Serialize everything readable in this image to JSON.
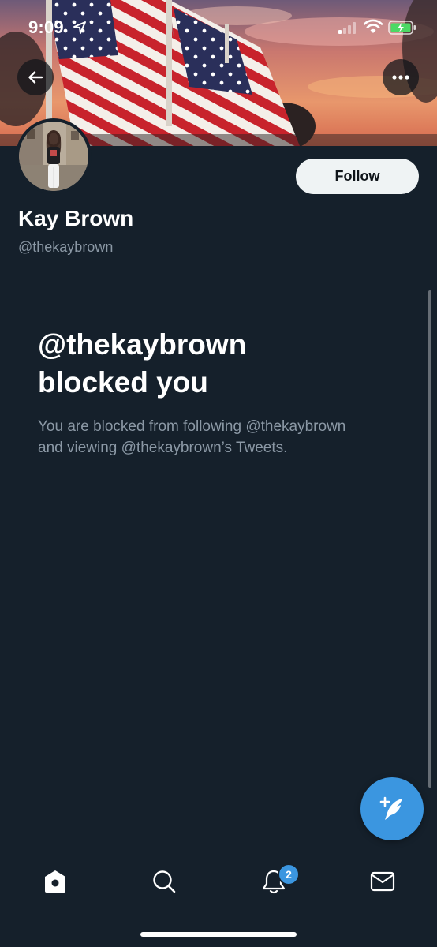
{
  "status_bar": {
    "time": "9:09",
    "icons": [
      "location-arrow-icon",
      "cellular-signal-icon",
      "wifi-icon",
      "battery-charging-icon"
    ]
  },
  "header": {
    "back_icon": "arrow-left-icon",
    "more_icon": "more-horizontal-icon",
    "banner": "american-flags-sunset-photo"
  },
  "profile": {
    "display_name": "Kay Brown",
    "handle": "@thekaybrown",
    "follow_label": "Follow"
  },
  "blocked": {
    "title_line1": "@thekaybrown",
    "title_line2": "blocked you",
    "desc_line1": "You are blocked from following @thekaybrown",
    "desc_line2": "and viewing @thekaybrown’s Tweets."
  },
  "compose": {
    "icon": "compose-tweet-icon"
  },
  "tab_bar": {
    "items": [
      "home-icon",
      "search-icon",
      "notifications-icon",
      "messages-icon"
    ],
    "notification_badge": "2"
  },
  "colors": {
    "background": "#15202b",
    "accent": "#3b96e0",
    "secondary_text": "#8b98a5",
    "follow_button": "#eff3f4"
  }
}
